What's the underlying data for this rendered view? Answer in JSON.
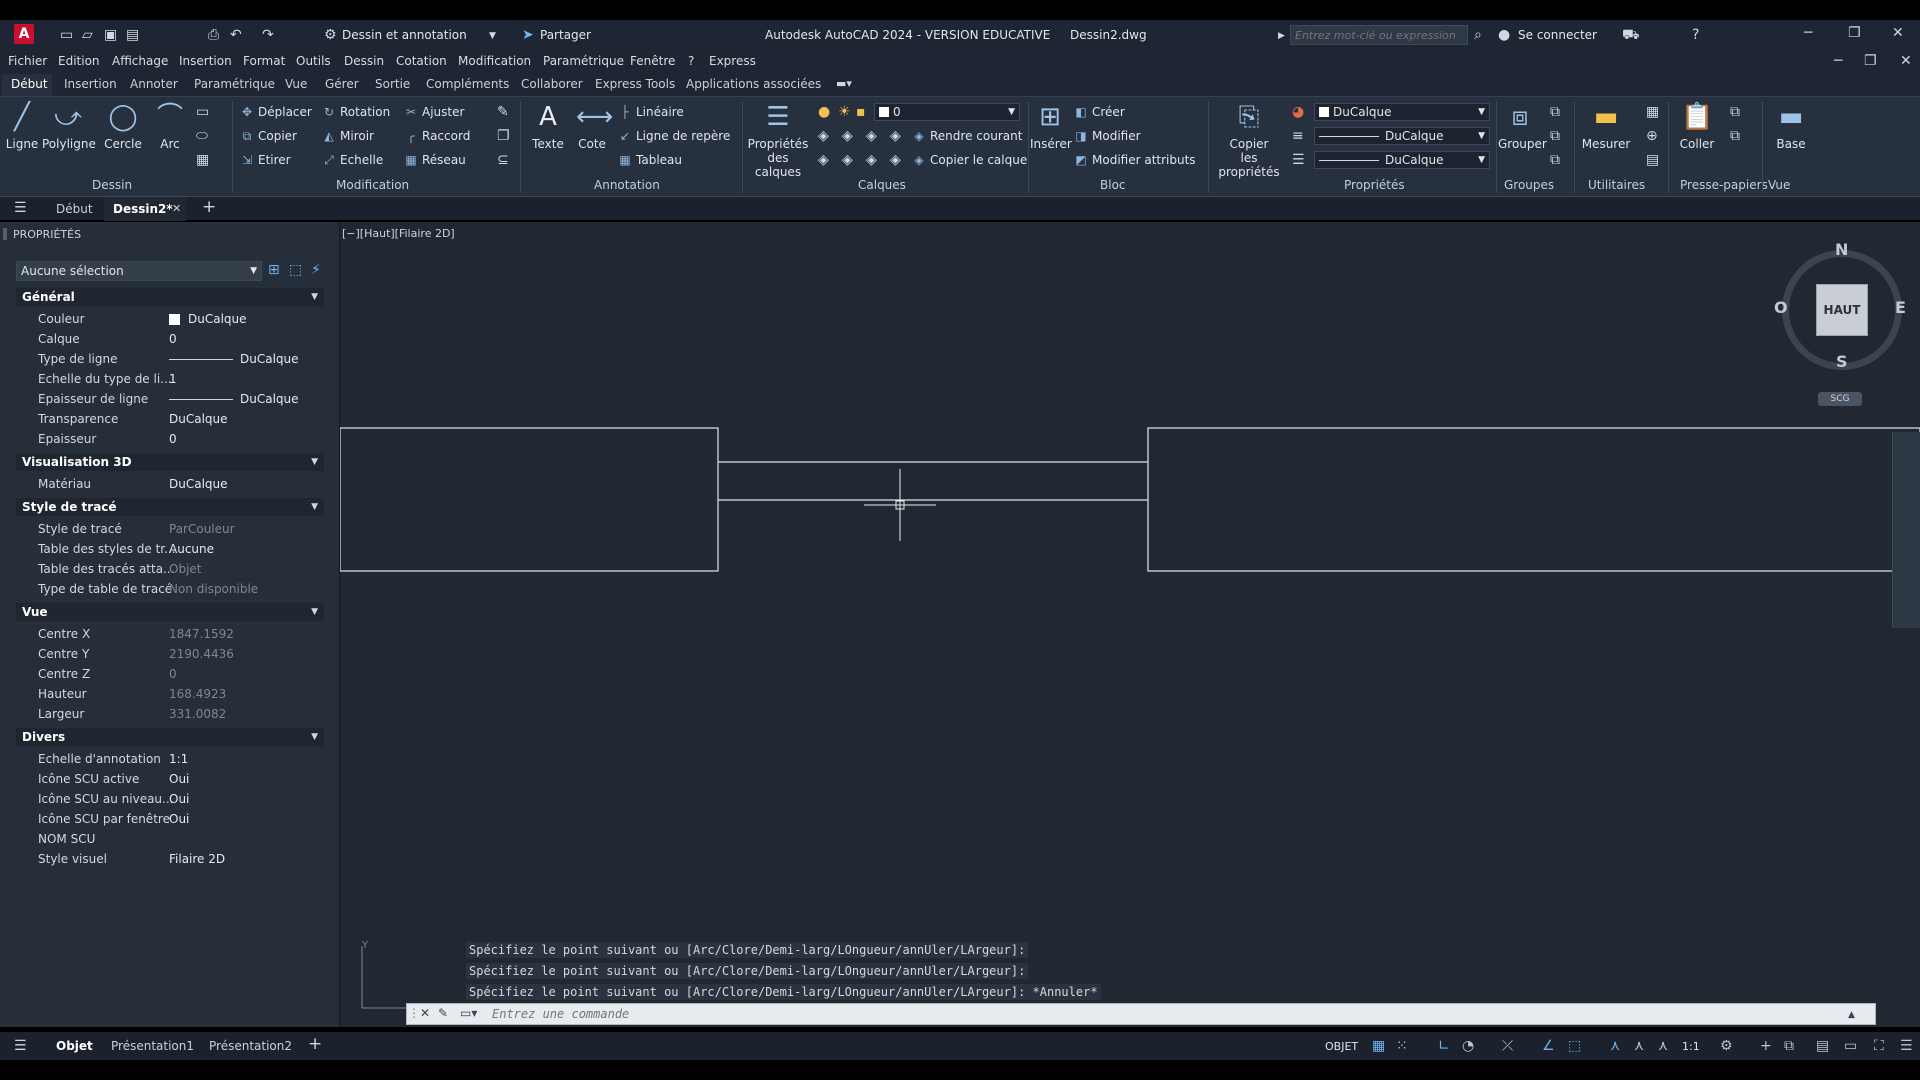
{
  "title_bar": {
    "workspace": "Dessin et annotation",
    "share": "Partager",
    "app_title": "Autodesk AutoCAD 2024 - VERSION EDUCATIVE",
    "file_name": "Dessin2.dwg",
    "search_placeholder": "Entrez mot-clé ou expression",
    "sign_in": "Se connecter"
  },
  "menu": [
    "Fichier",
    "Edition",
    "Affichage",
    "Insertion",
    "Format",
    "Outils",
    "Dessin",
    "Cotation",
    "Modification",
    "Paramétrique",
    "Fenêtre",
    "?",
    "Express"
  ],
  "ribbon_tabs": [
    "Début",
    "Insertion",
    "Annoter",
    "Paramétrique",
    "Vue",
    "Gérer",
    "Sortie",
    "Compléments",
    "Collaborer",
    "Express Tools",
    "Applications associées"
  ],
  "ribbon": {
    "dessin": {
      "ligne": "Ligne",
      "polyligne": "Polyligne",
      "cercle": "Cercle",
      "arc": "Arc",
      "title": "Dessin"
    },
    "modification": {
      "deplacer": "Déplacer",
      "rotation": "Rotation",
      "ajuster": "Ajuster",
      "copier": "Copier",
      "miroir": "Miroir",
      "raccord": "Raccord",
      "etirer": "Etirer",
      "echelle": "Echelle",
      "reseau": "Réseau",
      "title": "Modification"
    },
    "annotation": {
      "texte": "Texte",
      "cote": "Cote",
      "lineaire": "Linéaire",
      "ligne_repere": "Ligne de repère",
      "tableau": "Tableau",
      "title": "Annotation"
    },
    "calques": {
      "proprietes_line1": "Propriétés",
      "proprietes_line2": "des calques",
      "current_layer": "0",
      "rendre_courant": "Rendre courant",
      "copier_calque": "Copier le calque",
      "title": "Calques"
    },
    "bloc": {
      "inserer": "Insérer",
      "creer": "Créer",
      "modifier": "Modifier",
      "modifier_attributs": "Modifier attributs",
      "title": "Bloc"
    },
    "proprietes": {
      "copier_line1": "Copier",
      "copier_line2": "les propriétés",
      "couleur": "DuCalque",
      "type_ligne": "DuCalque",
      "epaisseur": "DuCalque",
      "title": "Propriétés"
    },
    "groupes": {
      "grouper": "Grouper",
      "title": "Groupes"
    },
    "utilitaires": {
      "mesurer": "Mesurer",
      "title": "Utilitaires"
    },
    "presse_papiers": {
      "coller": "Coller",
      "title": "Presse-papiers"
    },
    "vue": {
      "base": "Base",
      "title": "Vue"
    }
  },
  "doc_tabs": {
    "start": "Début",
    "current": "Dessin2*"
  },
  "properties": {
    "panel_title": "PROPRIÉTÉS",
    "selection": "Aucune sélection",
    "sections": [
      {
        "title": "Général",
        "rows": [
          {
            "k": "Couleur",
            "v": "DuCalque"
          },
          {
            "k": "Calque",
            "v": "0"
          },
          {
            "k": "Type de ligne",
            "v": "DuCalque"
          },
          {
            "k": "Echelle du type de li...",
            "v": "1"
          },
          {
            "k": "Epaisseur de ligne",
            "v": "DuCalque"
          },
          {
            "k": "Transparence",
            "v": "DuCalque"
          },
          {
            "k": "Epaisseur",
            "v": "0"
          }
        ]
      },
      {
        "title": "Visualisation 3D",
        "rows": [
          {
            "k": "Matériau",
            "v": "DuCalque"
          }
        ]
      },
      {
        "title": "Style de tracé",
        "rows": [
          {
            "k": "Style de tracé",
            "v": "ParCouleur"
          },
          {
            "k": "Table des styles de tr...",
            "v": "Aucune"
          },
          {
            "k": "Table des tracés atta...",
            "v": "Objet"
          },
          {
            "k": "Type de table de tracé",
            "v": "Non disponible"
          }
        ]
      },
      {
        "title": "Vue",
        "rows": [
          {
            "k": "Centre X",
            "v": "1847.1592"
          },
          {
            "k": "Centre Y",
            "v": "2190.4436"
          },
          {
            "k": "Centre Z",
            "v": "0"
          },
          {
            "k": "Hauteur",
            "v": "168.4923"
          },
          {
            "k": "Largeur",
            "v": "331.0082"
          }
        ]
      },
      {
        "title": "Divers",
        "rows": [
          {
            "k": "Echelle d'annotation",
            "v": "1:1"
          },
          {
            "k": "Icône SCU active",
            "v": "Oui"
          },
          {
            "k": "Icône SCU au niveau...",
            "v": "Oui"
          },
          {
            "k": "Icône SCU par fenêtre",
            "v": "Oui"
          },
          {
            "k": "NOM SCU",
            "v": ""
          },
          {
            "k": "Style visuel",
            "v": "Filaire 2D"
          }
        ]
      }
    ]
  },
  "viewport": {
    "label": "[−][Haut][Filaire 2D]",
    "viewcube": {
      "top": "HAUT",
      "n": "N",
      "s": "S",
      "e": "E",
      "w": "O",
      "scu": "SCG"
    }
  },
  "command_history": [
    "Spécifiez le point suivant ou [Arc/Clore/Demi-larg/LOngueur/annUler/LArgeur]:",
    "Spécifiez le point suivant ou [Arc/Clore/Demi-larg/LOngueur/annUler/LArgeur]:",
    "Spécifiez le point suivant ou [Arc/Clore/Demi-larg/LOngueur/annUler/LArgeur]: *Annuler*"
  ],
  "command_placeholder": "Entrez une commande",
  "layout_tabs": [
    "Objet",
    "Présentation1",
    "Présentation2"
  ],
  "status": {
    "mode": "OBJET",
    "scale": "1:1"
  },
  "colors": {
    "accent": "#c8102e",
    "canvas": "#212832",
    "panel": "#262e3a"
  }
}
